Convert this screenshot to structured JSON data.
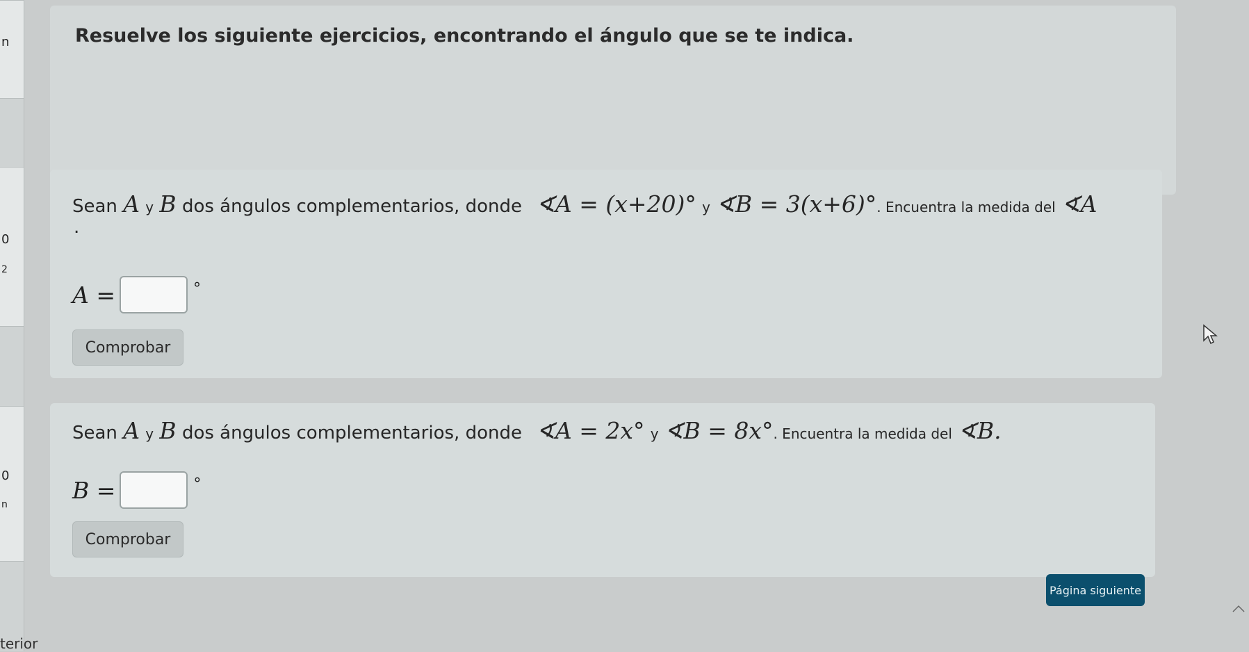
{
  "left_sidebar": {
    "items": [
      "n",
      "0",
      "2",
      "0",
      "n"
    ]
  },
  "header": {
    "title": "Resuelve los siguiente ejercicios, encontrando el ángulo que se te indica."
  },
  "questions": [
    {
      "sean": "Sean",
      "var_a": "A",
      "y": "y",
      "var_b": "B",
      "text": "dos ángulos complementarios, donde",
      "angle_a": "∢A = (x+20)°",
      "y2": "y",
      "angle_b": "∢B = 3(x+6)°",
      "ask": ". Encuentra la medida del",
      "target": "∢A",
      "period": ".",
      "answer_label": "A =",
      "answer_value": "",
      "degree": "°",
      "button": "Comprobar"
    },
    {
      "sean": "Sean",
      "var_a": "A",
      "y": "y",
      "var_b": "B",
      "text": "dos ángulos complementarios, donde",
      "angle_a": "∢A = 2x°",
      "y2": "y",
      "angle_b": "∢B = 8x°",
      "ask": ". Encuentra la medida del",
      "target": "∢B.",
      "answer_label": "B =",
      "answer_value": "",
      "degree": "°",
      "button": "Comprobar"
    }
  ],
  "footer": {
    "next_button": "Página siguiente",
    "left_label": "terior"
  },
  "colors": {
    "background": "#c9cccc",
    "panel": "#d6dcdc",
    "button": "#c2c8c8",
    "next_button": "#0b4f6d"
  }
}
